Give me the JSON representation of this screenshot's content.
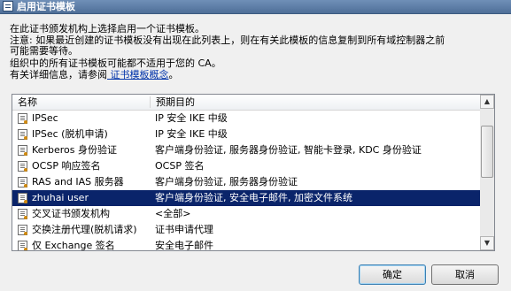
{
  "window": {
    "title": "启用证书模板"
  },
  "description": {
    "line1": "在此证书颁发机构上选择启用一个证书模板。",
    "line2": "注意: 如果最近创建的证书模板没有出现在此列表上，则在有关此模板的信息复制到所有域控制器之前",
    "line3": "可能需要等待。",
    "line4": "组织中的所有证书模板可能都不适用于您的 CA。",
    "line5_prefix": "有关详细信息，请参阅",
    "line5_link": " 证书模板概念",
    "line5_suffix": "。"
  },
  "list": {
    "columns": [
      "名称",
      "预期目的"
    ],
    "rows": [
      {
        "name": "IPSec",
        "purpose": "IP 安全 IKE 中级"
      },
      {
        "name": "IPSec (脱机申请)",
        "purpose": "IP 安全 IKE 中级"
      },
      {
        "name": "Kerberos 身份验证",
        "purpose": "客户端身份验证, 服务器身份验证, 智能卡登录, KDC 身份验证"
      },
      {
        "name": "OCSP 响应签名",
        "purpose": "OCSP 签名"
      },
      {
        "name": "RAS and IAS 服务器",
        "purpose": "客户端身份验证, 服务器身份验证"
      },
      {
        "name": "zhuhai user",
        "purpose": "客户端身份验证, 安全电子邮件, 加密文件系统",
        "selected": true
      },
      {
        "name": "交叉证书颁发机构",
        "purpose": "<全部>"
      },
      {
        "name": "交换注册代理(脱机请求)",
        "purpose": "证书申请代理"
      },
      {
        "name": "仅 Exchange 签名",
        "purpose": "安全电子邮件"
      },
      {
        "name": "代码签名",
        "purpose": "代码签名"
      }
    ]
  },
  "buttons": {
    "ok": "确定",
    "cancel": "取消"
  },
  "colors": {
    "selection": "#0a246a",
    "titlebar": "#5b7ba6"
  }
}
